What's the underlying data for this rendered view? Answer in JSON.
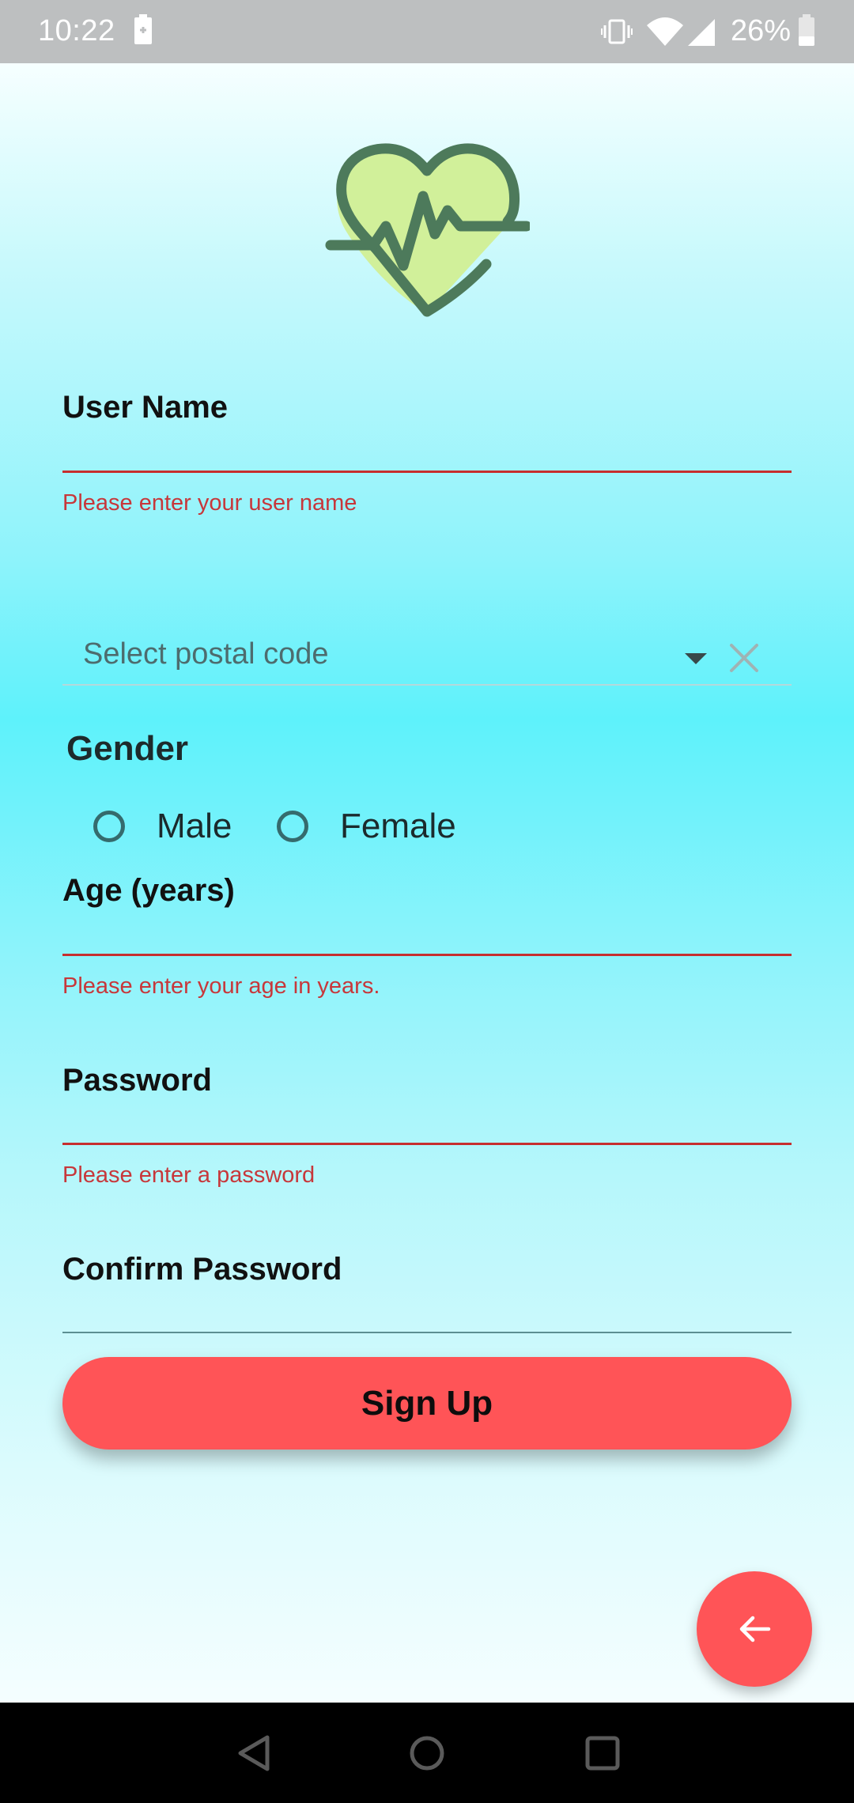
{
  "status_bar": {
    "time": "10:22",
    "battery_percent": "26%",
    "icons": [
      "battery-charging-icon",
      "vibrate-icon",
      "wifi-icon",
      "cell-signal-icon",
      "battery-icon"
    ]
  },
  "app": {
    "logo_icon": "heart-pulse-icon",
    "fields": {
      "username": {
        "label": "User Name",
        "value": "",
        "error": "Please enter your user name"
      },
      "age": {
        "label": "Age (years)",
        "value": "",
        "error": "Please enter your age in years."
      },
      "password": {
        "label": "Password",
        "value": "",
        "error": "Please enter a password"
      },
      "confirm_password": {
        "label": "Confirm Password",
        "value": ""
      }
    },
    "postal_code": {
      "placeholder": "Select postal code",
      "dropdown_icon": "dropdown-arrow-icon",
      "clear_icon": "close-icon"
    },
    "gender": {
      "title": "Gender",
      "options": [
        "Male",
        "Female"
      ],
      "selected": null
    },
    "signup_button": "Sign Up",
    "fab_icon": "arrow-back-icon"
  },
  "nav_bar": {
    "icons": [
      "back-nav-icon",
      "home-nav-icon",
      "recents-nav-icon"
    ]
  },
  "colors": {
    "accent": "#ff5457",
    "error": "#c7373a",
    "logo_fill": "#d1f09a",
    "logo_stroke": "#4d7a5b",
    "status_bar": "#bdbfc0"
  }
}
